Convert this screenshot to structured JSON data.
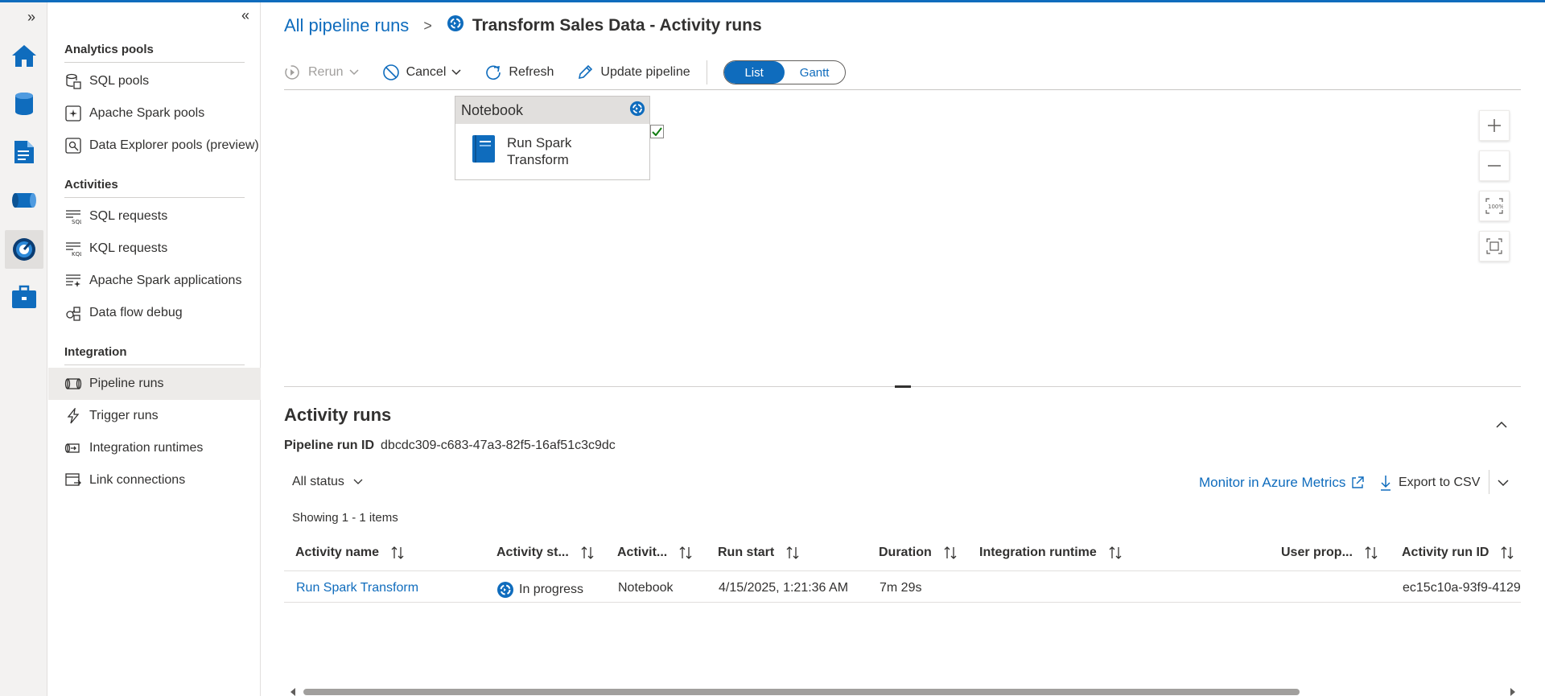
{
  "colors": {
    "accent": "#0f6cbd",
    "text": "#323130",
    "selected_bg": "#edebe9"
  },
  "rail": {
    "expand_glyph": "»",
    "icons": [
      "home-icon",
      "data-icon",
      "develop-icon",
      "integrate-icon",
      "monitor-icon",
      "manage-icon"
    ],
    "active": "monitor-icon"
  },
  "subnav": {
    "collapse_glyph": "«",
    "sections": {
      "analytics": "Analytics pools",
      "activities": "Activities",
      "integration": "Integration"
    },
    "items": {
      "sql_pools": "SQL pools",
      "spark_pools": "Apache Spark pools",
      "dx_pools": "Data Explorer pools (preview)",
      "sql_requests": "SQL requests",
      "kql_requests": "KQL requests",
      "spark_apps": "Apache Spark applications",
      "dataflow_debug": "Data flow debug",
      "pipeline_runs": "Pipeline runs",
      "trigger_runs": "Trigger runs",
      "integration_runtimes": "Integration runtimes",
      "link_connections": "Link connections"
    },
    "selected": "pipeline_runs"
  },
  "header": {
    "breadcrumb_link": "All pipeline runs",
    "separator": ">",
    "title": "Transform Sales Data - Activity runs"
  },
  "toolbar": {
    "rerun": "Rerun",
    "cancel": "Cancel",
    "refresh": "Refresh",
    "update": "Update pipeline",
    "view_list": "List",
    "view_gantt": "Gantt",
    "selected_view": "List"
  },
  "canvas": {
    "node_type": "Notebook",
    "node_name": "Run Spark Transform",
    "node_checked": true
  },
  "panel": {
    "title": "Activity runs",
    "run_id_label": "Pipeline run ID",
    "run_id": "dbcdc309-c683-47a3-82f5-16af51c3c9dc",
    "status_filter": "All status",
    "monitor_link": "Monitor in Azure Metrics",
    "export": "Export to CSV",
    "showing": "Showing 1 - 1 items"
  },
  "table": {
    "columns": {
      "name": "Activity name",
      "status": "Activity st...",
      "type": "Activit...",
      "start": "Run start",
      "duration": "Duration",
      "ir": "Integration runtime",
      "userprops": "User prop...",
      "runid": "Activity run ID"
    },
    "rows": [
      {
        "name": "Run Spark Transform",
        "status": "In progress",
        "type": "Notebook",
        "start": "4/15/2025, 1:21:36 AM",
        "duration": "7m 29s",
        "ir": "",
        "userprops": "",
        "runid": "ec15c10a-93f9-4129"
      }
    ]
  }
}
